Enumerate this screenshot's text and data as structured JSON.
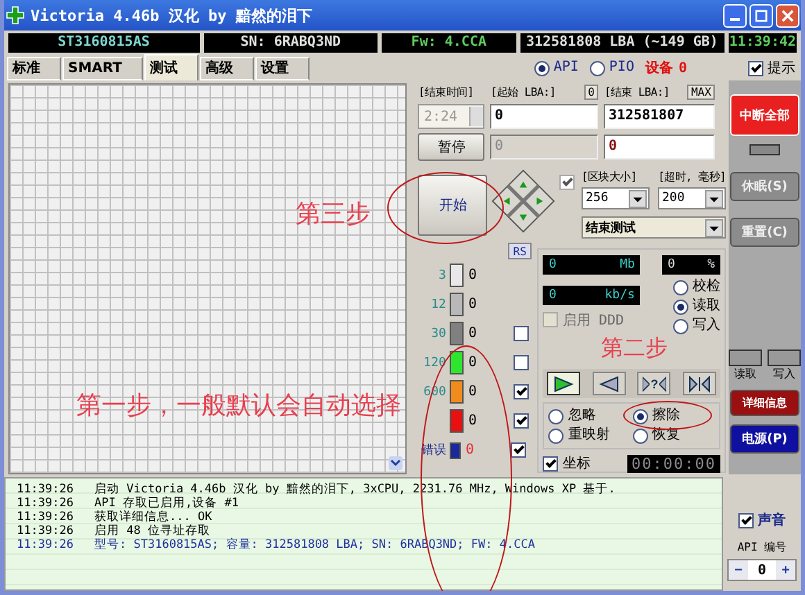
{
  "window": {
    "title": "Victoria 4.46b 汉化 by 黯然的泪下"
  },
  "info_bar": [
    "ST3160815AS",
    "SN: 6RABQ3ND",
    "Fw: 4.CCA",
    "312581808 LBA (~149 GB)",
    "11:39:42"
  ],
  "scan_option": {
    "checked": true
  },
  "tabs": [
    {
      "label": "标准",
      "selected": false
    },
    {
      "label": "SMART",
      "selected": false
    },
    {
      "label": "测试",
      "selected": true
    },
    {
      "label": "高级",
      "selected": false
    },
    {
      "label": "设置",
      "selected": false
    }
  ],
  "mode_radios": [
    {
      "label": "API",
      "selected": true
    },
    {
      "label": "PIO",
      "selected": false
    }
  ],
  "device": {
    "label": "设备",
    "value": "0"
  },
  "hints": {
    "label": "提示",
    "checked": true
  },
  "test": {
    "end_time_label": "[结束时间]",
    "end_time": "2:24",
    "start_lba_label": "[起始 LBA:]",
    "start_lba_button": "0",
    "start_lba": "0",
    "end_lba_label": "[结束 LBA:]",
    "end_lba_button": "MAX",
    "end_lba": "312581807",
    "current_start": "0",
    "current_end": "0",
    "pause": "暂停",
    "start": "开始",
    "block_size_label": "[区块大小]",
    "block_size": "256",
    "timeout_label": "[超时, 毫秒]",
    "timeout": "200",
    "end_action": "结束测试"
  },
  "rs_button": "RS",
  "legend": [
    {
      "kind": "bar",
      "threshold": "3",
      "count": "0",
      "color": "#e8e8e8"
    },
    {
      "kind": "bar",
      "threshold": "12",
      "count": "0",
      "color": "#b8b8b8"
    },
    {
      "kind": "check",
      "threshold": "30",
      "count": "0",
      "color": "#808080",
      "checked": false
    },
    {
      "kind": "check",
      "threshold": "120",
      "count": "0",
      "color": "#2ee62e",
      "checked": false
    },
    {
      "kind": "check",
      "threshold": "600",
      "count": "0",
      "color": "#f08c1c",
      "checked": true
    },
    {
      "kind": "check",
      "count": "0",
      "color": "#e81010",
      "checked": true
    },
    {
      "kind": "error",
      "threshold": "错误",
      "count": "0",
      "color": "#1a2a9a",
      "checked": true
    }
  ],
  "stats": {
    "mb": "0",
    "mb_unit": "Mb",
    "percent": "0",
    "percent_unit": "%",
    "speed": "0",
    "speed_unit": "kb/s"
  },
  "scan_modes": [
    {
      "label": "校检",
      "selected": false
    },
    {
      "label": "读取",
      "selected": true
    },
    {
      "label": "写入",
      "selected": false
    }
  ],
  "ddd": {
    "label": "启用 DDD",
    "checked": false
  },
  "player": [
    {
      "kind": "play",
      "selected": true
    },
    {
      "kind": "back",
      "selected": false
    },
    {
      "kind": "query",
      "label": "?",
      "selected": false
    },
    {
      "kind": "end",
      "selected": false
    }
  ],
  "repair_modes": [
    {
      "label": "忽略",
      "selected": false
    },
    {
      "label": "擦除",
      "selected": true
    },
    {
      "label": "重映射",
      "selected": false
    },
    {
      "label": "恢复",
      "selected": false
    }
  ],
  "grid_check": {
    "label": "坐标",
    "checked": true
  },
  "timer": "00:00:00",
  "side_buttons": {
    "stop_all": "中断全部",
    "sleep": "休眠(S)",
    "reset": "重置(C)",
    "read": "读取",
    "write": "写入",
    "details": "详细信息",
    "power": "电源(P)"
  },
  "log": [
    {
      "kind": "plain",
      "time": "11:39:26",
      "text": "启动 Victoria 4.46b 汉化 by 黯然的泪下, 3xCPU, 2231.76 MHz, Windows XP 基于."
    },
    {
      "kind": "plain",
      "time": "11:39:26",
      "text": "API 存取已启用,设备 #1"
    },
    {
      "kind": "plain",
      "time": "11:39:26",
      "text": "获取详细信息... OK"
    },
    {
      "kind": "plain",
      "time": "11:39:26",
      "text": "启用 48 位寻址存取"
    },
    {
      "kind": "info",
      "time": "11:39:26",
      "text": "型号:  ST3160815AS;      容量: 312581808 LBA; SN: 6RABQ3ND; FW: 4.CCA"
    }
  ],
  "sound": {
    "label": "声音",
    "checked": true
  },
  "api_number": {
    "label": "API 编号",
    "minus": "−",
    "value": "0",
    "plus": "+"
  },
  "annotations": {
    "step3": "第三步",
    "step2": "第二步",
    "step1": "第一步，一般默认会自动选择"
  }
}
